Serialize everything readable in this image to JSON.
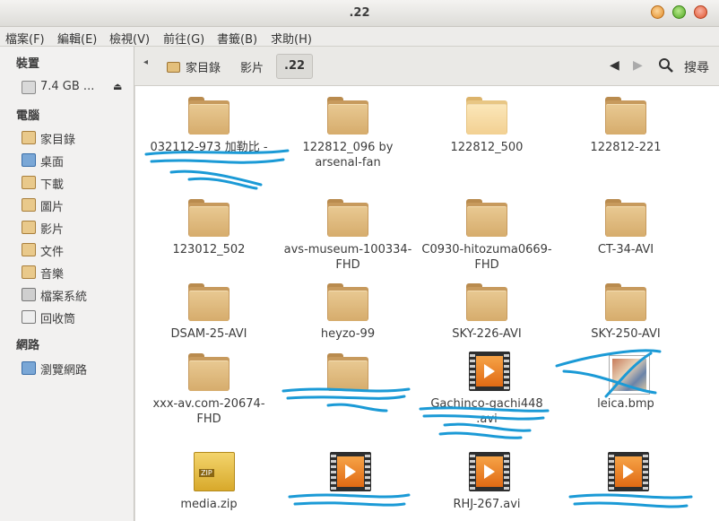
{
  "window": {
    "title": ".22"
  },
  "menu": [
    "檔案(F)",
    "編輯(E)",
    "檢視(V)",
    "前往(G)",
    "書籤(B)",
    "求助(H)"
  ],
  "sidebar": {
    "devices_header": "裝置",
    "devices": [
      {
        "label": "7.4 GB ...",
        "icon": "drive-icon"
      }
    ],
    "computer_header": "電腦",
    "computer": [
      {
        "label": "家目錄",
        "icon": "home-folder-icon"
      },
      {
        "label": "桌面",
        "icon": "desktop-icon"
      },
      {
        "label": "下載",
        "icon": "downloads-icon"
      },
      {
        "label": "圖片",
        "icon": "pictures-icon"
      },
      {
        "label": "影片",
        "icon": "videos-icon"
      },
      {
        "label": "文件",
        "icon": "documents-icon"
      },
      {
        "label": "音樂",
        "icon": "music-icon"
      },
      {
        "label": "檔案系統",
        "icon": "filesystem-icon"
      },
      {
        "label": "回收筒",
        "icon": "trash-icon"
      }
    ],
    "network_header": "網路",
    "network": [
      {
        "label": "瀏覽網路",
        "icon": "network-icon"
      }
    ]
  },
  "toolbar": {
    "breadcrumbs": [
      "家目錄",
      "影片",
      ".22"
    ],
    "search_label": "搜尋"
  },
  "files": [
    {
      "name": "032112-973 加勒比 -",
      "type": "folder"
    },
    {
      "name": "122812_096 by arsenal-fan",
      "type": "folder"
    },
    {
      "name": "122812_500",
      "type": "folder-light"
    },
    {
      "name": "122812-221",
      "type": "folder"
    },
    {
      "name": "123012_502",
      "type": "folder"
    },
    {
      "name": "avs-museum-100334-FHD",
      "type": "folder"
    },
    {
      "name": "C0930-hitozuma0669-FHD",
      "type": "folder"
    },
    {
      "name": "CT-34-AVI",
      "type": "folder"
    },
    {
      "name": "DSAM-25-AVI",
      "type": "folder"
    },
    {
      "name": "heyzo-99",
      "type": "folder"
    },
    {
      "name": "SKY-226-AVI",
      "type": "folder"
    },
    {
      "name": "SKY-250-AVI",
      "type": "folder"
    },
    {
      "name": "xxx-av.com-20674-FHD",
      "type": "folder"
    },
    {
      "name": "",
      "type": "folder"
    },
    {
      "name": "Gachinco-gachi448 .avi",
      "type": "video"
    },
    {
      "name": "leica.bmp",
      "type": "image"
    },
    {
      "name": "media.zip",
      "type": "zip"
    },
    {
      "name": "",
      "type": "video"
    },
    {
      "name": "RHJ-267.avi",
      "type": "video"
    },
    {
      "name": "",
      "type": "video"
    }
  ]
}
